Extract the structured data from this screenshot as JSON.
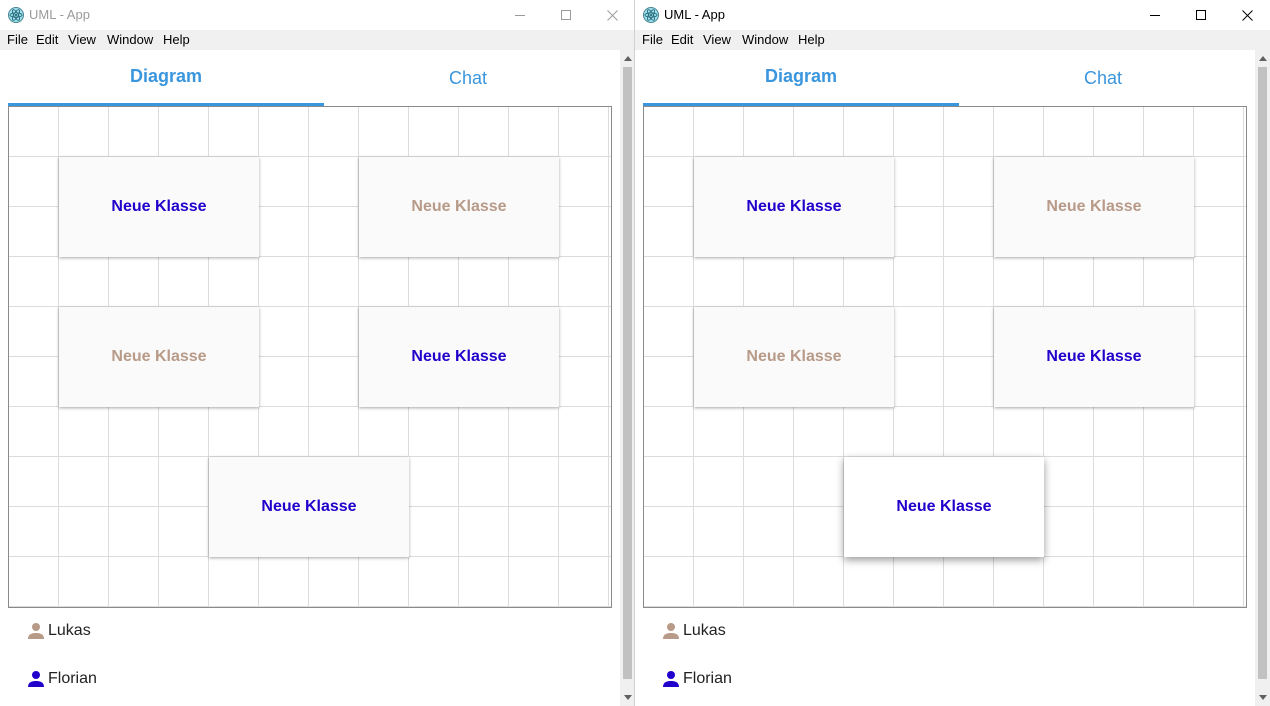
{
  "colors": {
    "accent": "#3a96dd",
    "user_florian": "#2200cc",
    "user_lukas": "#b89a88"
  },
  "windows": [
    {
      "title": "UML - App",
      "title_active": false,
      "menu": [
        "File",
        "Edit",
        "View",
        "Window",
        "Help"
      ],
      "tabs": [
        {
          "label": "Diagram",
          "active": true
        },
        {
          "label": "Chat",
          "active": false
        }
      ],
      "classes": [
        {
          "label": "Neue Klasse",
          "owner": "florian"
        },
        {
          "label": "Neue Klasse",
          "owner": "lukas"
        },
        {
          "label": "Neue Klasse",
          "owner": "lukas"
        },
        {
          "label": "Neue Klasse",
          "owner": "florian"
        },
        {
          "label": "Neue Klasse",
          "owner": "florian"
        }
      ],
      "users": [
        {
          "name": "Lukas",
          "icon": "person-icon"
        },
        {
          "name": "Florian",
          "icon": "person-icon"
        }
      ]
    },
    {
      "title": "UML - App",
      "title_active": true,
      "menu": [
        "File",
        "Edit",
        "View",
        "Window",
        "Help"
      ],
      "tabs": [
        {
          "label": "Diagram",
          "active": true
        },
        {
          "label": "Chat",
          "active": false
        }
      ],
      "classes": [
        {
          "label": "Neue Klasse",
          "owner": "florian"
        },
        {
          "label": "Neue Klasse",
          "owner": "lukas"
        },
        {
          "label": "Neue Klasse",
          "owner": "lukas"
        },
        {
          "label": "Neue Klasse",
          "owner": "florian"
        },
        {
          "label": "Neue Klasse",
          "owner": "florian",
          "selected": true
        }
      ],
      "users": [
        {
          "name": "Lukas",
          "icon": "person-icon"
        },
        {
          "name": "Florian",
          "icon": "person-icon"
        }
      ]
    }
  ]
}
